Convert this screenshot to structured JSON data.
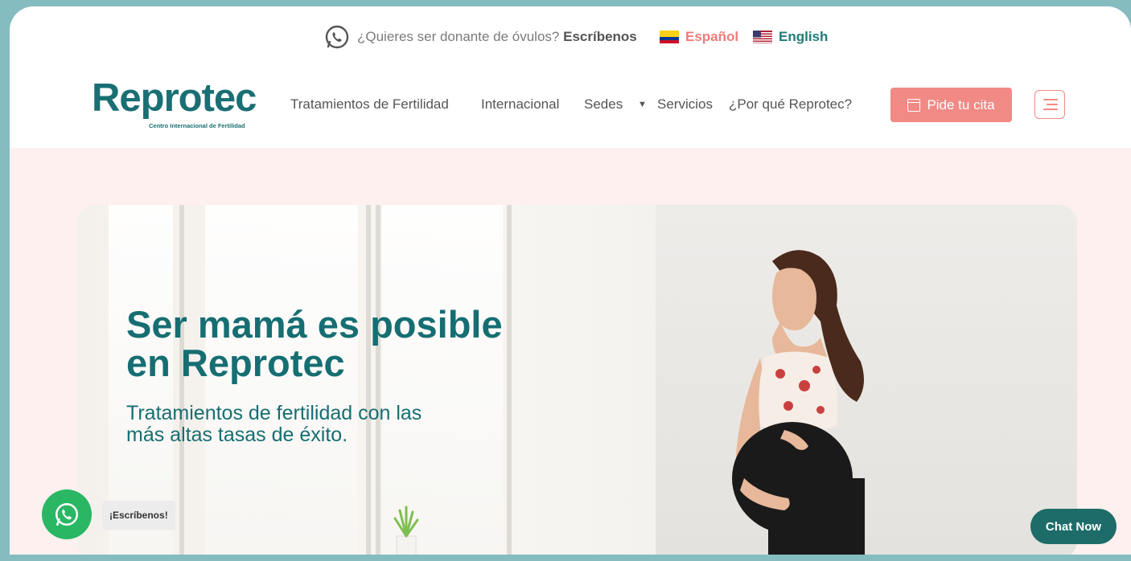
{
  "topbar": {
    "donor_question": "¿Quieres ser donante de óvulos?",
    "donor_link": "Escríbenos",
    "languages": [
      {
        "label": "Español",
        "flag": "colombia-flag-icon"
      },
      {
        "label": "English",
        "flag": "usa-flag-icon"
      }
    ]
  },
  "header": {
    "logo_text": "Reprotec",
    "logo_tagline": "Centro Internacional de Fertilidad",
    "nav": [
      {
        "label": "Tratamientos de Fertilidad"
      },
      {
        "label": "Internacional"
      },
      {
        "label": "Sedes"
      },
      {
        "label": "Servicios"
      },
      {
        "label": "¿Por qué Reprotec?"
      }
    ],
    "cta_label": "Pide tu cita",
    "menu_icon": "hamburger-icon"
  },
  "hero": {
    "title_line1": "Ser mamá es posible",
    "title_line2": "en Reprotec",
    "subtitle_line1": "Tratamientos de fertilidad con las",
    "subtitle_line2": "más altas tasas de éxito."
  },
  "widgets": {
    "whatsapp_label": "¡Escríbenos!",
    "chat_label": "Chat Now"
  },
  "colors": {
    "brand_teal": "#1a6f73",
    "accent_coral": "#f18a85",
    "frame": "#85bcc0",
    "whatsapp_green": "#29b764"
  }
}
